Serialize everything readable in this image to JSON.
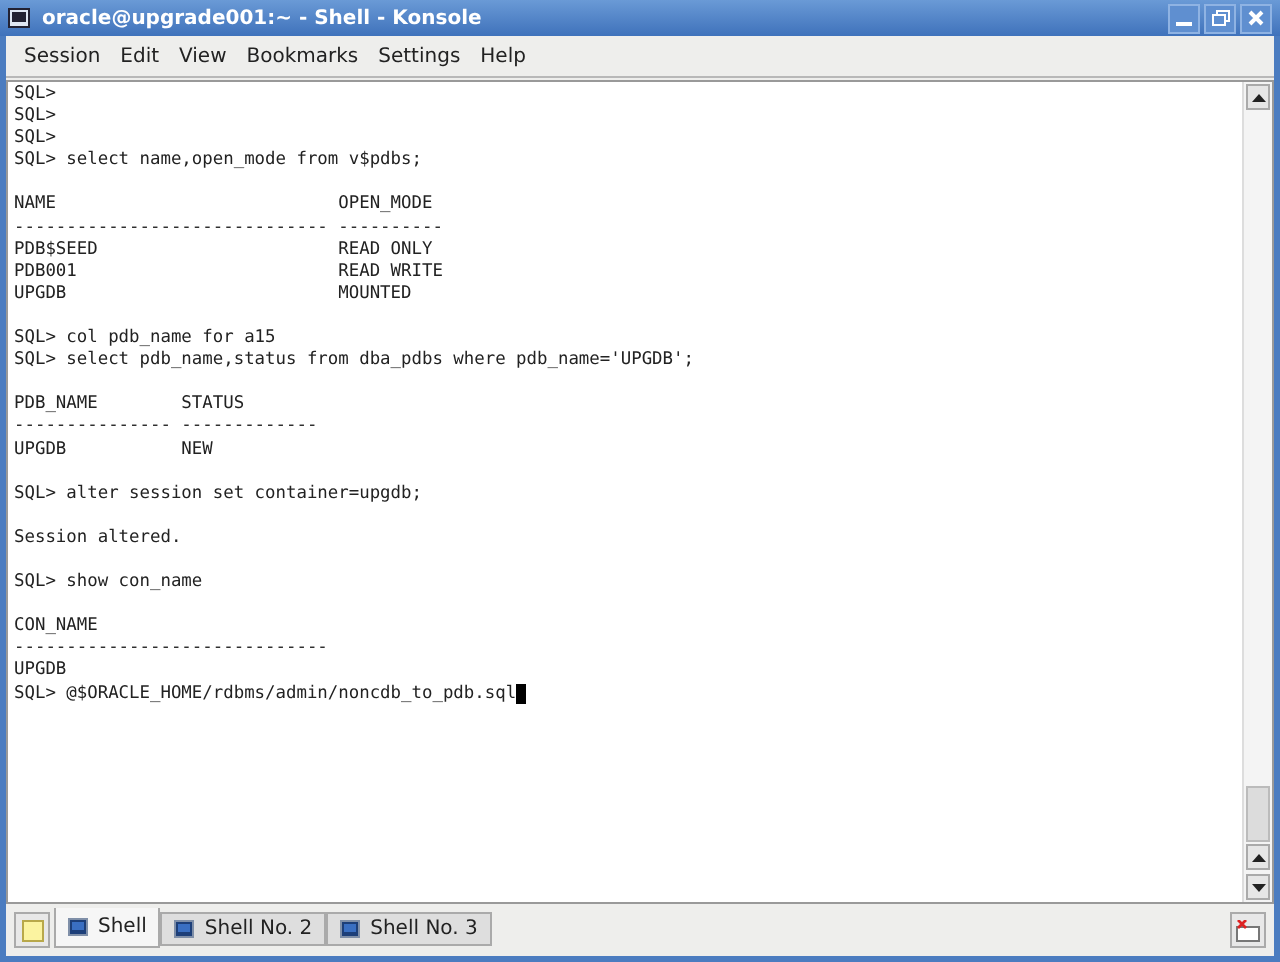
{
  "window": {
    "title": "oracle@upgrade001:~ - Shell - Konsole"
  },
  "menu": [
    "Session",
    "Edit",
    "View",
    "Bookmarks",
    "Settings",
    "Help"
  ],
  "terminal": {
    "cursor": true,
    "lines": [
      {
        "kind": "text",
        "text": "SQL>"
      },
      {
        "kind": "text",
        "text": "SQL>"
      },
      {
        "kind": "text",
        "text": "SQL>"
      },
      {
        "kind": "text",
        "text": "SQL> select name,open_mode from v$pdbs;"
      },
      {
        "kind": "blank"
      },
      {
        "kind": "text",
        "text": "NAME                           OPEN_MODE"
      },
      {
        "kind": "text",
        "text": "------------------------------ ----------"
      },
      {
        "kind": "text",
        "text": "PDB$SEED                       READ ONLY"
      },
      {
        "kind": "text",
        "text": "PDB001                         READ WRITE"
      },
      {
        "kind": "text",
        "text": "UPGDB                          MOUNTED"
      },
      {
        "kind": "blank"
      },
      {
        "kind": "text",
        "text": "SQL> col pdb_name for a15"
      },
      {
        "kind": "text",
        "text": "SQL> select pdb_name,status from dba_pdbs where pdb_name='UPGDB';"
      },
      {
        "kind": "blank"
      },
      {
        "kind": "text",
        "text": "PDB_NAME        STATUS"
      },
      {
        "kind": "text",
        "text": "--------------- -------------"
      },
      {
        "kind": "text",
        "text": "UPGDB           NEW"
      },
      {
        "kind": "blank"
      },
      {
        "kind": "text",
        "text": "SQL> alter session set container=upgdb;"
      },
      {
        "kind": "blank"
      },
      {
        "kind": "text",
        "text": "Session altered."
      },
      {
        "kind": "blank"
      },
      {
        "kind": "text",
        "text": "SQL> show con_name"
      },
      {
        "kind": "blank"
      },
      {
        "kind": "text",
        "text": "CON_NAME"
      },
      {
        "kind": "text",
        "text": "------------------------------"
      },
      {
        "kind": "text",
        "text": "UPGDB"
      },
      {
        "kind": "text",
        "text": "SQL> @$ORACLE_HOME/rdbms/admin/noncdb_to_pdb.sql"
      }
    ]
  },
  "tabs": [
    {
      "label": "Shell",
      "selected": true
    },
    {
      "label": "Shell No. 2",
      "selected": false
    },
    {
      "label": "Shell No. 3",
      "selected": false
    }
  ]
}
